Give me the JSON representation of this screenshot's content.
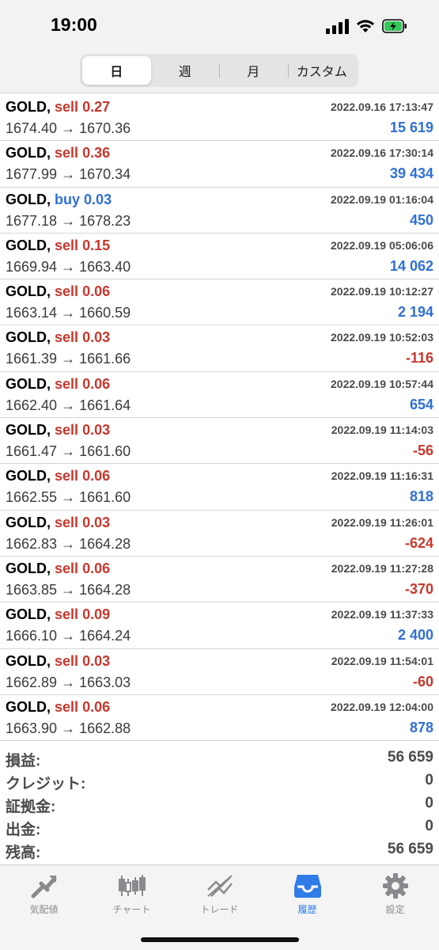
{
  "status_bar": {
    "time": "19:00"
  },
  "segments": [
    {
      "label": "日",
      "active": true
    },
    {
      "label": "週",
      "active": false
    },
    {
      "label": "月",
      "active": false
    },
    {
      "label": "カスタム",
      "active": false
    }
  ],
  "trades": [
    {
      "symbol": "GOLD,",
      "side": "sell",
      "lots": "0.27",
      "datetime": "2022.09.16 17:13:47",
      "prices": "1674.40 → 1670.36",
      "profit": "15 619",
      "profit_sign": "pos"
    },
    {
      "symbol": "GOLD,",
      "side": "sell",
      "lots": "0.36",
      "datetime": "2022.09.16 17:30:14",
      "prices": "1677.99 → 1670.34",
      "profit": "39 434",
      "profit_sign": "pos"
    },
    {
      "symbol": "GOLD,",
      "side": "buy",
      "lots": "0.03",
      "datetime": "2022.09.19 01:16:04",
      "prices": "1677.18 → 1678.23",
      "profit": "450",
      "profit_sign": "pos"
    },
    {
      "symbol": "GOLD,",
      "side": "sell",
      "lots": "0.15",
      "datetime": "2022.09.19 05:06:06",
      "prices": "1669.94 → 1663.40",
      "profit": "14 062",
      "profit_sign": "pos"
    },
    {
      "symbol": "GOLD,",
      "side": "sell",
      "lots": "0.06",
      "datetime": "2022.09.19 10:12:27",
      "prices": "1663.14 → 1660.59",
      "profit": "2 194",
      "profit_sign": "pos"
    },
    {
      "symbol": "GOLD,",
      "side": "sell",
      "lots": "0.03",
      "datetime": "2022.09.19 10:52:03",
      "prices": "1661.39 → 1661.66",
      "profit": "-116",
      "profit_sign": "neg"
    },
    {
      "symbol": "GOLD,",
      "side": "sell",
      "lots": "0.06",
      "datetime": "2022.09.19 10:57:44",
      "prices": "1662.40 → 1661.64",
      "profit": "654",
      "profit_sign": "pos"
    },
    {
      "symbol": "GOLD,",
      "side": "sell",
      "lots": "0.03",
      "datetime": "2022.09.19 11:14:03",
      "prices": "1661.47 → 1661.60",
      "profit": "-56",
      "profit_sign": "neg"
    },
    {
      "symbol": "GOLD,",
      "side": "sell",
      "lots": "0.06",
      "datetime": "2022.09.19 11:16:31",
      "prices": "1662.55 → 1661.60",
      "profit": "818",
      "profit_sign": "pos"
    },
    {
      "symbol": "GOLD,",
      "side": "sell",
      "lots": "0.03",
      "datetime": "2022.09.19 11:26:01",
      "prices": "1662.83 → 1664.28",
      "profit": "-624",
      "profit_sign": "neg"
    },
    {
      "symbol": "GOLD,",
      "side": "sell",
      "lots": "0.06",
      "datetime": "2022.09.19 11:27:28",
      "prices": "1663.85 → 1664.28",
      "profit": "-370",
      "profit_sign": "neg"
    },
    {
      "symbol": "GOLD,",
      "side": "sell",
      "lots": "0.09",
      "datetime": "2022.09.19 11:37:33",
      "prices": "1666.10 → 1664.24",
      "profit": "2 400",
      "profit_sign": "pos"
    },
    {
      "symbol": "GOLD,",
      "side": "sell",
      "lots": "0.03",
      "datetime": "2022.09.19 11:54:01",
      "prices": "1662.89 → 1663.03",
      "profit": "-60",
      "profit_sign": "neg"
    },
    {
      "symbol": "GOLD,",
      "side": "sell",
      "lots": "0.06",
      "datetime": "2022.09.19 12:04:00",
      "prices": "1663.90 → 1662.88",
      "profit": "878",
      "profit_sign": "pos"
    }
  ],
  "summary": [
    {
      "label": "損益:",
      "value": "56 659"
    },
    {
      "label": "クレジット:",
      "value": "0"
    },
    {
      "label": "証拠金:",
      "value": "0"
    },
    {
      "label": "出金:",
      "value": "0"
    },
    {
      "label": "残高:",
      "value": "56 659"
    }
  ],
  "tabs": [
    {
      "label": "気配値",
      "icon": "quotes-icon",
      "active": false
    },
    {
      "label": "チャート",
      "icon": "chart-icon",
      "active": false
    },
    {
      "label": "トレード",
      "icon": "trade-icon",
      "active": false
    },
    {
      "label": "履歴",
      "icon": "history-icon",
      "active": true
    },
    {
      "label": "設定",
      "icon": "settings-icon",
      "active": false
    }
  ],
  "colors": {
    "sell": "#c8372d",
    "buy": "#2f6fd6",
    "profit_positive": "#2f6fd6",
    "profit_negative": "#c8372d",
    "tab_active": "#2f7ce8",
    "tab_inactive": "#8a8a8e"
  }
}
